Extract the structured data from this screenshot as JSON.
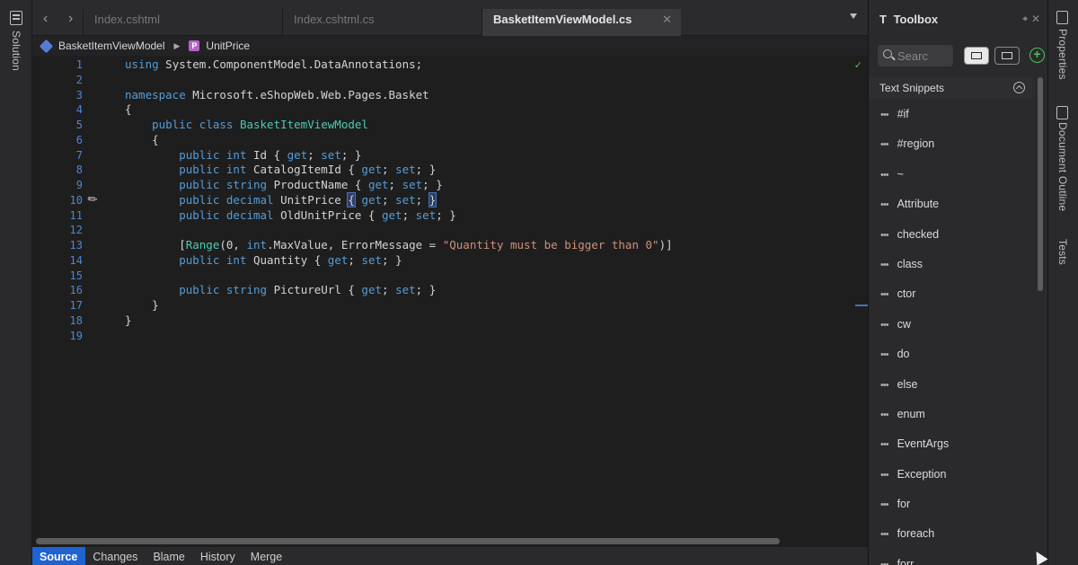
{
  "left_sidebar": {
    "label": "Solution"
  },
  "tabs": [
    {
      "label": "Index.cshtml",
      "active": false
    },
    {
      "label": "Index.cshtml.cs",
      "active": false
    },
    {
      "label": "BasketItemViewModel.cs",
      "active": true
    }
  ],
  "tab_close_glyph": "✕",
  "breadcrumb": {
    "class_name": "BasketItemViewModel",
    "member_name": "UnitPrice",
    "member_badge": "P"
  },
  "editor": {
    "line_numbers": [
      "1",
      "2",
      "3",
      "4",
      "5",
      "6",
      "7",
      "8",
      "9",
      "10",
      "11",
      "12",
      "13",
      "14",
      "15",
      "16",
      "17",
      "18",
      "19"
    ]
  },
  "bottom_tabs": [
    {
      "label": "Source",
      "active": true
    },
    {
      "label": "Changes",
      "active": false
    },
    {
      "label": "Blame",
      "active": false
    },
    {
      "label": "History",
      "active": false
    },
    {
      "label": "Merge",
      "active": false
    }
  ],
  "toolbox": {
    "title": "Toolbox",
    "search_placeholder": "Searc",
    "section_title": "Text Snippets",
    "items": [
      "#if",
      "#region",
      "~",
      "Attribute",
      "checked",
      "class",
      "ctor",
      "cw",
      "do",
      "else",
      "enum",
      "EventArgs",
      "Exception",
      "for",
      "foreach",
      "forr"
    ]
  },
  "right_sidebar": {
    "labels": [
      "Properties",
      "Document Outline",
      "Tests"
    ]
  },
  "colors": {
    "accent": "#1f63d1",
    "keyword": "#569cd6",
    "type": "#4ec9b0",
    "string": "#ce9178",
    "add": "#4fbf5a"
  }
}
